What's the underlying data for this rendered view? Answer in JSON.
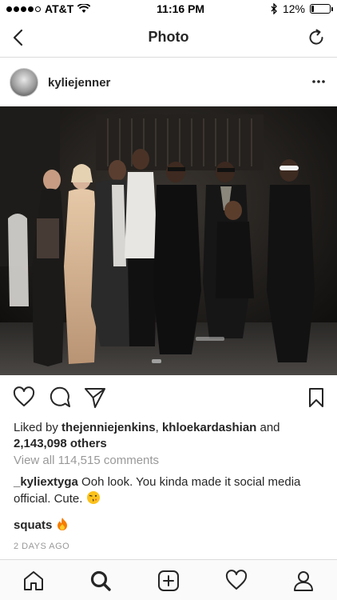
{
  "status_bar": {
    "carrier": "AT&T",
    "time": "11:16 PM",
    "battery_percent": "12%",
    "battery_level": 0.12
  },
  "nav": {
    "title": "Photo",
    "back_icon": "chevron-left-icon",
    "refresh_icon": "refresh-icon"
  },
  "post": {
    "username": "kyliejenner",
    "more_icon": "more-dots-icon",
    "likes_prefix": "Liked by ",
    "liker_1": "thejenniejenkins",
    "likes_sep": ", ",
    "liker_2": "khloekardashian",
    "likes_and": " and",
    "likes_count": "2,143,098 others",
    "view_all_comments": "View all 114,515 comments",
    "comments": [
      {
        "user": "_kyliextyga",
        "text": " Ooh look. You kinda made it social media official. Cute. ",
        "emoji": "kiss-face-emoji"
      },
      {
        "user": "squats",
        "text": " ",
        "emoji": "fire-emoji"
      }
    ],
    "timestamp": "2 DAYS AGO"
  },
  "tabs": [
    "home-icon",
    "search-icon",
    "add-icon",
    "heart-icon",
    "profile-icon"
  ],
  "colors": {
    "text": "#262626",
    "muted": "#999999",
    "divider": "#dbdbdb"
  }
}
